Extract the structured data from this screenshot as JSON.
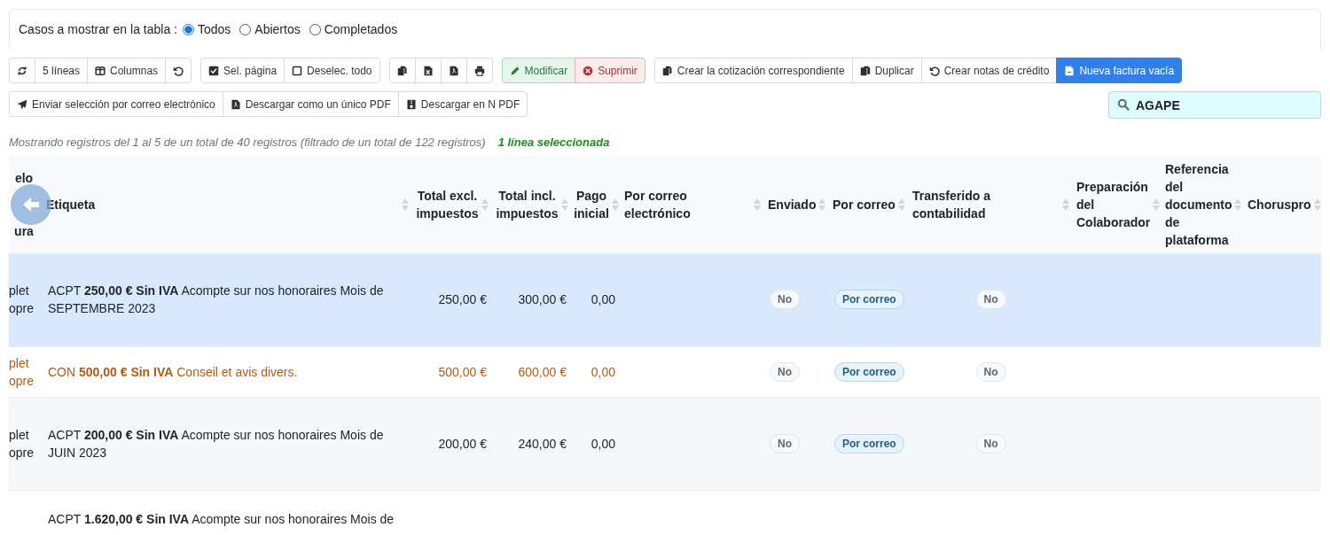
{
  "filter": {
    "label": "Casos a mostrar en la tabla :",
    "options": [
      {
        "label": "Todos",
        "selected": true
      },
      {
        "label": "Abiertos",
        "selected": false
      },
      {
        "label": "Completados",
        "selected": false
      }
    ]
  },
  "toolbar": [
    [
      {
        "kind": "default"
      },
      {
        "label": "5 líneas",
        "kind": "default"
      },
      {
        "label": "Columnas",
        "kind": "default"
      },
      {
        "kind": "default"
      }
    ],
    [
      {
        "label": "Sel. página",
        "kind": "default"
      },
      {
        "label": "Deselec. todo",
        "kind": "default"
      }
    ],
    [
      {
        "kind": "default"
      },
      {
        "kind": "default"
      },
      {
        "kind": "default"
      },
      {
        "kind": "default"
      }
    ],
    [
      {
        "label": "Modificar",
        "kind": "success"
      },
      {
        "label": "Suprimir",
        "kind": "danger"
      }
    ],
    [
      {
        "label": "Crear la cotización correspondiente",
        "kind": "default"
      },
      {
        "label": "Duplicar",
        "kind": "default"
      },
      {
        "label": "Crear notas de crédito",
        "kind": "default"
      },
      {
        "label": "Nueva factura vacía",
        "kind": "primary"
      }
    ]
  ],
  "toolbar_2": [
    [
      {
        "label": "Enviar selección por correo electrónico",
        "kind": "default"
      },
      {
        "label": "Descargar como un único PDF",
        "kind": "default"
      },
      {
        "label": "Descargar en N PDF",
        "kind": "default"
      }
    ]
  ],
  "search": {
    "value": "AGAPE"
  },
  "info": {
    "text": "Mostrando registros del 1 al 5 de un total de 40 registros (filtrado de un total de 122 registros)",
    "selection": "1 línea seleccionada"
  },
  "table": {
    "columns": [
      {
        "lines": [
          "elo",
          "ura"
        ]
      },
      {
        "label": "Etiqueta"
      },
      {
        "label": "Total excl. impuestos"
      },
      {
        "label": "Total incl. impuestos"
      },
      {
        "label": "Pago inicial"
      },
      {
        "label": "Por correo electrónico"
      },
      {
        "label": "Enviado"
      },
      {
        "label": "Por correo"
      },
      {
        "label": "Transferido a contabilidad"
      },
      {
        "label": "Preparación del Colaborador"
      },
      {
        "label": "Referencia del documento de plataforma"
      },
      {
        "label": "Choruspro"
      }
    ],
    "rows": [
      {
        "selected": true,
        "kind": "normal",
        "column_1": "plet opre",
        "label": "ACPT **250,00 € Sin IVA** Acompte sur nos honoraires Mois de SEPTEMBRE 2023",
        "total_excl": "250,00 €",
        "total_incl": "300,00 €",
        "pago_inicial": "0,00",
        "enviado": "No",
        "por_correo": "Por correo",
        "transferido": "No"
      },
      {
        "selected": false,
        "kind": "warning",
        "column_1": "plet opre",
        "label": "CON **500,00 € Sin IVA** Conseil et avis divers.",
        "total_excl": "500,00 €",
        "total_incl": "600,00 €",
        "pago_inicial": "0,00",
        "enviado": "No",
        "por_correo": "Por correo",
        "transferido": "No"
      },
      {
        "selected": false,
        "kind": "normal",
        "column_1": "plet opre",
        "label": "ACPT **200,00 € Sin IVA** Acompte sur nos honoraires Mois de JUIN 2023",
        "total_excl": "200,00 €",
        "total_incl": "240,00 €",
        "pago_inicial": "0,00",
        "enviado": "No",
        "por_correo": "Por correo",
        "transferido": "No"
      },
      {
        "selected": false,
        "kind": "normal",
        "label": "ACPT **1.620,00 € Sin IVA** Acompte sur nos honoraires Mois de"
      }
    ]
  }
}
